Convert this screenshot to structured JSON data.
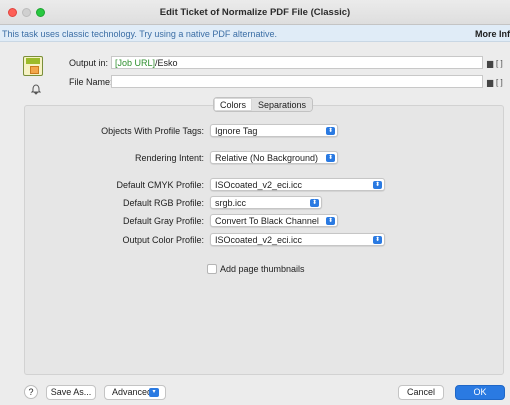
{
  "window": {
    "title": "Edit Ticket of Normalize PDF File (Classic)"
  },
  "banner": {
    "text": "This task uses classic technology. Try using a native PDF alternative.",
    "link": "More Inf"
  },
  "header": {
    "icon": "esko-pdf-icon",
    "bell_icon": "bell-icon",
    "output_label": "Output in:",
    "output_value_token": "[Job URL]",
    "output_value_rest": "/Esko",
    "filename_label": "File Name:",
    "filename_value": "",
    "folder_glyph": "▆",
    "brackets": "[ ]"
  },
  "tabs": [
    {
      "label": "Colors",
      "active": true
    },
    {
      "label": "Separations",
      "active": false
    }
  ],
  "settings": {
    "objects_profile_tags": {
      "label": "Objects With Profile Tags:",
      "value": "Ignore Tag"
    },
    "rendering_intent": {
      "label": "Rendering Intent:",
      "value": "Relative (No Background)"
    },
    "default_cmyk": {
      "label": "Default CMYK Profile:",
      "value": "ISOcoated_v2_eci.icc"
    },
    "default_rgb": {
      "label": "Default RGB Profile:",
      "value": "srgb.icc"
    },
    "default_gray": {
      "label": "Default Gray Profile:",
      "value": "Convert To Black Channel"
    },
    "output_color": {
      "label": "Output Color Profile:",
      "value": "ISOcoated_v2_eci.icc"
    },
    "chevron_glyph": "⬍"
  },
  "add_page_thumbnails": {
    "label": "Add page thumbnails",
    "checked": false
  },
  "footer": {
    "help": "?",
    "save_as": "Save As...",
    "advanced": "Advanced",
    "cancel": "Cancel",
    "ok": "OK"
  },
  "colors": {
    "accent": "#2a7ae2",
    "banner_text": "#3b6ea5",
    "job_url": "#2d8f2d"
  }
}
